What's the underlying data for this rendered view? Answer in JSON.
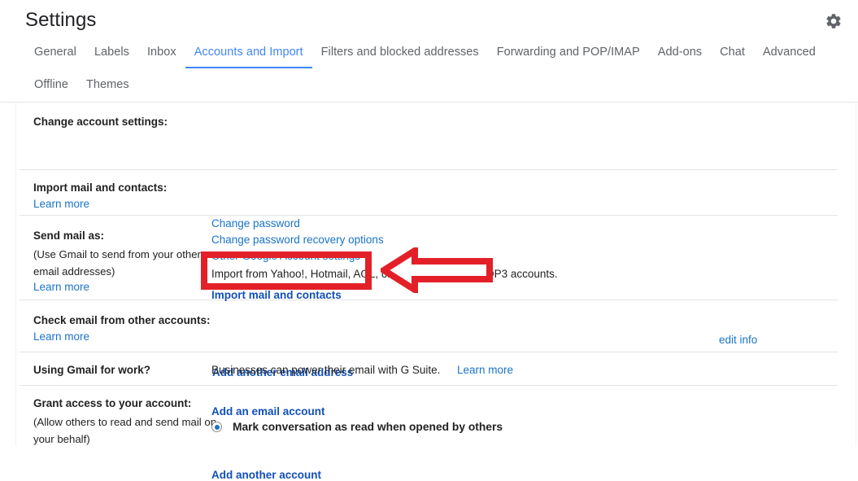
{
  "header": {
    "title": "Settings",
    "gear_icon": "gear-icon"
  },
  "tabs": {
    "row1": [
      {
        "label": "General",
        "active": false
      },
      {
        "label": "Labels",
        "active": false
      },
      {
        "label": "Inbox",
        "active": false
      },
      {
        "label": "Accounts and Import",
        "active": true
      },
      {
        "label": "Filters and blocked addresses",
        "active": false
      },
      {
        "label": "Forwarding and POP/IMAP",
        "active": false
      },
      {
        "label": "Add-ons",
        "active": false
      },
      {
        "label": "Chat",
        "active": false
      },
      {
        "label": "Advanced",
        "active": false
      }
    ],
    "row2": [
      {
        "label": "Offline",
        "active": false
      },
      {
        "label": "Themes",
        "active": false
      }
    ]
  },
  "sections": {
    "change_account": {
      "label": "Change account settings:",
      "links": [
        "Change password",
        "Change password recovery options",
        "Other Google Account settings"
      ]
    },
    "import_mail": {
      "label": "Import mail and contacts:",
      "learn_more": "Learn more",
      "description": "Import from Yahoo!, Hotmail, AOL, or other webmail or POP3 accounts.",
      "action": "Import mail and contacts"
    },
    "send_mail_as": {
      "label": "Send mail as:",
      "sub_line1": "(Use Gmail to send from your other",
      "sub_line2": "email addresses)",
      "learn_more": "Learn more",
      "action": "Add another email address",
      "edit_info": "edit info"
    },
    "check_email": {
      "label": "Check email from other accounts:",
      "learn_more": "Learn more",
      "action": "Add an email account"
    },
    "gmail_for_work": {
      "label": "Using Gmail for work?",
      "description": "Businesses can power their email with G Suite.",
      "learn_more": "Learn more"
    },
    "grant_access": {
      "label": "Grant access to your account:",
      "sub_line1": "(Allow others to read and send mail on",
      "sub_line2": "your behalf)",
      "action": "Add another account",
      "mark_read_option": "Mark conversation as read when opened by others"
    }
  },
  "annotations": {
    "highlight_color": "#e32028",
    "arrow_color": "#e32028",
    "arrow_direction": "left"
  },
  "colors": {
    "accent_blue": "#4285f4",
    "link_blue": "#1a73c8",
    "link_bold_blue": "#1250b8",
    "text": "#222222",
    "muted": "#5f6368",
    "divider": "#e4e4e4",
    "annotation_red": "#e32028"
  }
}
